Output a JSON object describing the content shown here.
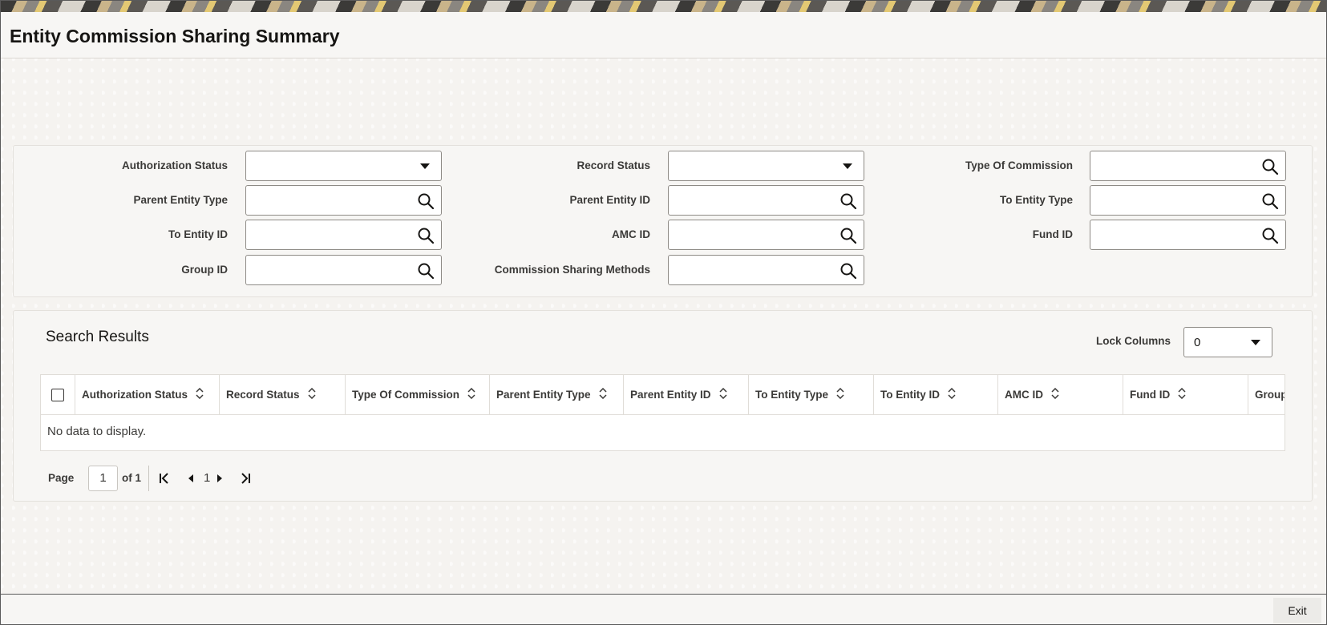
{
  "page": {
    "title": "Entity Commission Sharing Summary"
  },
  "criteria": {
    "authorization_status": {
      "label": "Authorization Status",
      "value": ""
    },
    "record_status": {
      "label": "Record Status",
      "value": ""
    },
    "type_of_commission": {
      "label": "Type Of Commission",
      "value": ""
    },
    "parent_entity_type": {
      "label": "Parent Entity Type",
      "value": ""
    },
    "parent_entity_id": {
      "label": "Parent Entity ID",
      "value": ""
    },
    "to_entity_type": {
      "label": "To Entity Type",
      "value": ""
    },
    "to_entity_id": {
      "label": "To Entity ID",
      "value": ""
    },
    "amc_id": {
      "label": "AMC ID",
      "value": ""
    },
    "fund_id": {
      "label": "Fund ID",
      "value": ""
    },
    "group_id": {
      "label": "Group ID",
      "value": ""
    },
    "commission_sharing_methods": {
      "label": "Commission Sharing Methods",
      "value": ""
    }
  },
  "results": {
    "title": "Search Results",
    "lock_columns_label": "Lock Columns",
    "lock_columns_value": "0",
    "columns": [
      "Authorization Status",
      "Record Status",
      "Type Of Commission",
      "Parent Entity Type",
      "Parent Entity ID",
      "To Entity Type",
      "To Entity ID",
      "AMC ID",
      "Fund ID",
      "Group"
    ],
    "empty_message": "No data to display."
  },
  "pager": {
    "page_label": "Page",
    "current_page": "1",
    "of_label": "of 1",
    "nav_page": "1"
  },
  "footer": {
    "exit_label": "Exit"
  },
  "icons": {
    "search": "search-icon",
    "dropdown": "chevron-down-icon",
    "sort": "sort-icon",
    "first": "first-page-icon",
    "prev": "previous-page-icon",
    "next": "next-page-icon",
    "last": "last-page-icon"
  }
}
